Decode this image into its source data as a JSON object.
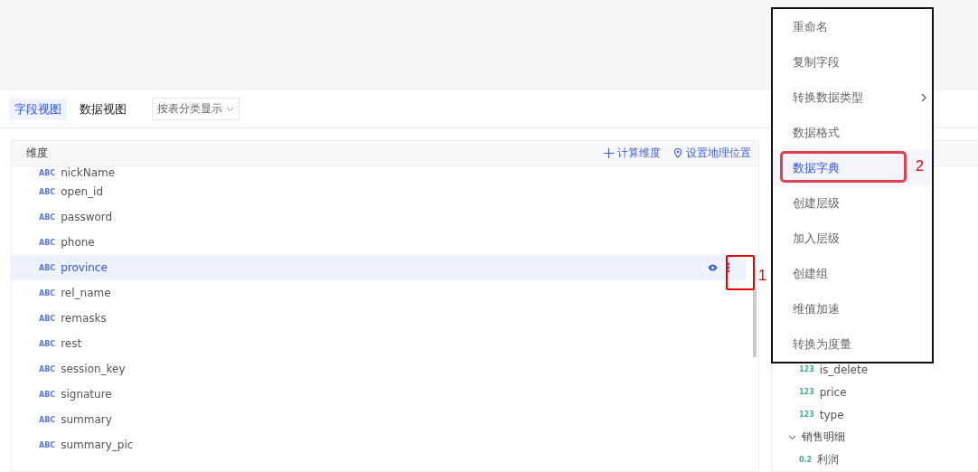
{
  "tabs": [
    {
      "label": "字段视图",
      "selected": true
    },
    {
      "label": "数据视图",
      "selected": false
    }
  ],
  "group_select": {
    "value": "按表分类显示"
  },
  "dimensions": {
    "title": "维度",
    "actions": [
      {
        "kind": "add",
        "label": "计算维度"
      },
      {
        "kind": "geo",
        "label": "设置地理位置"
      }
    ],
    "fields": [
      {
        "type": "ABC",
        "name": "nickName",
        "selected": false
      },
      {
        "type": "ABC",
        "name": "open_id",
        "selected": false
      },
      {
        "type": "ABC",
        "name": "password",
        "selected": false
      },
      {
        "type": "ABC",
        "name": "phone",
        "selected": false
      },
      {
        "type": "ABC",
        "name": "province",
        "selected": true
      },
      {
        "type": "ABC",
        "name": "rel_name",
        "selected": false
      },
      {
        "type": "ABC",
        "name": "remasks",
        "selected": false
      },
      {
        "type": "ABC",
        "name": "rest",
        "selected": false
      },
      {
        "type": "ABC",
        "name": "session_key",
        "selected": false
      },
      {
        "type": "ABC",
        "name": "signature",
        "selected": false
      },
      {
        "type": "ABC",
        "name": "summary",
        "selected": false
      },
      {
        "type": "ABC",
        "name": "summary_pic",
        "selected": false
      }
    ]
  },
  "measures": {
    "items": [
      {
        "kind": "field",
        "type": "123",
        "name": "is_delete"
      },
      {
        "kind": "field",
        "type": "123",
        "name": "price"
      },
      {
        "kind": "field",
        "type": "123",
        "name": "type"
      },
      {
        "kind": "group",
        "name": "销售明细",
        "expanded": true
      },
      {
        "kind": "field",
        "type": "0.2",
        "name": "利润"
      }
    ]
  },
  "context_menu": {
    "items": [
      {
        "label": "重命名",
        "selected": false,
        "submenu": false
      },
      {
        "label": "复制字段",
        "selected": false,
        "submenu": false
      },
      {
        "label": "转换数据类型",
        "selected": false,
        "submenu": true
      },
      {
        "label": "数据格式",
        "selected": false,
        "submenu": false
      },
      {
        "label": "数据字典",
        "selected": true,
        "submenu": false
      },
      {
        "label": "创建层级",
        "selected": false,
        "submenu": false
      },
      {
        "label": "加入层级",
        "selected": false,
        "submenu": false
      },
      {
        "label": "创建组",
        "selected": false,
        "submenu": false
      },
      {
        "label": "维值加速",
        "selected": false,
        "submenu": false
      },
      {
        "label": "转换为度量",
        "selected": false,
        "submenu": false
      }
    ]
  },
  "annotations": [
    "1",
    "2"
  ]
}
